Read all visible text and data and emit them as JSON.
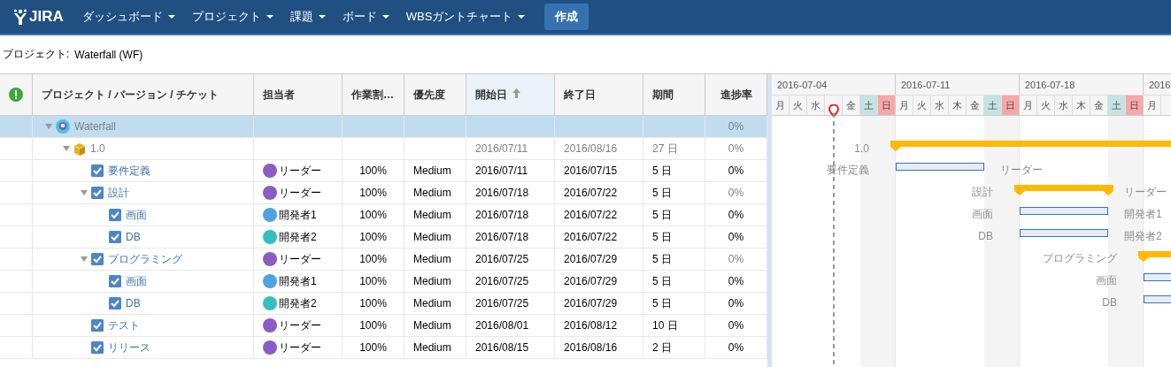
{
  "nav": {
    "logo": "JIRA",
    "menus": [
      {
        "label": "ダッシュボード"
      },
      {
        "label": "プロジェクト"
      },
      {
        "label": "課題"
      },
      {
        "label": "ボード"
      },
      {
        "label": "WBSガントチャート"
      }
    ],
    "create_button": "作成"
  },
  "project": {
    "label": "プロジェクト:",
    "value": "Waterfall (WF)"
  },
  "table": {
    "columns": [
      {
        "label": "プロジェクト / バージョン / チケット",
        "sorted": false
      },
      {
        "label": "担当者",
        "sorted": false
      },
      {
        "label": "作業割…",
        "sorted": false
      },
      {
        "label": "優先度",
        "sorted": false
      },
      {
        "label": "開始日",
        "sorted": true
      },
      {
        "label": "終了日",
        "sorted": false
      },
      {
        "label": "期間",
        "sorted": false
      },
      {
        "label": "進捗率",
        "sorted": false
      }
    ],
    "rows": [
      {
        "name": "Waterfall",
        "kind": "project",
        "selected": true,
        "expanded": true,
        "progress": "0%",
        "children": [
          {
            "name": "1.0",
            "kind": "version",
            "selected": false,
            "expanded": true,
            "start": "2016/07/11",
            "end": "2016/08/16",
            "duration": "27 日",
            "progress": "0%",
            "gantt_label": "1.0",
            "children": [
              {
                "name": "要件定義",
                "kind": "task",
                "selected": false,
                "assignee": "リーダー",
                "color": "#8a5cc4",
                "ratio": "100%",
                "priority": "Medium",
                "start": "2016/07/11",
                "end": "2016/07/15",
                "duration": "5 日",
                "progress": "0%",
                "gantt_label": "要件定義",
                "gantt_assignee": "リーダー"
              },
              {
                "name": "設計",
                "kind": "parent",
                "selected": false,
                "expanded": true,
                "assignee": "リーダー",
                "color": "#8a5cc4",
                "ratio": "100%",
                "priority": "Medium",
                "start": "2016/07/18",
                "end": "2016/07/22",
                "duration": "5 日",
                "progress": "0%",
                "gantt_label": "設計",
                "gantt_assignee": "リーダー",
                "children": [
                  {
                    "name": "画面",
                    "kind": "task",
                    "selected": false,
                    "assignee": "開発者1",
                    "color": "#4fa3e0",
                    "ratio": "100%",
                    "priority": "Medium",
                    "start": "2016/07/18",
                    "end": "2016/07/22",
                    "duration": "5 日",
                    "progress": "0%",
                    "gantt_label": "画面",
                    "gantt_assignee": "開発者1"
                  },
                  {
                    "name": "DB",
                    "kind": "task",
                    "selected": false,
                    "assignee": "開発者2",
                    "color": "#35bfbf",
                    "ratio": "100%",
                    "priority": "Medium",
                    "start": "2016/07/18",
                    "end": "2016/07/22",
                    "duration": "5 日",
                    "progress": "0%",
                    "gantt_label": "DB",
                    "gantt_assignee": "開発者2"
                  }
                ]
              },
              {
                "name": "プログラミング",
                "kind": "parent",
                "selected": false,
                "expanded": true,
                "assignee": "リーダー",
                "color": "#8a5cc4",
                "ratio": "100%",
                "priority": "Medium",
                "start": "2016/07/25",
                "end": "2016/07/29",
                "duration": "5 日",
                "progress": "0%",
                "gantt_label": "プログラミング",
                "children": [
                  {
                    "name": "画面",
                    "kind": "task",
                    "selected": false,
                    "assignee": "開発者1",
                    "color": "#4fa3e0",
                    "ratio": "100%",
                    "priority": "Medium",
                    "start": "2016/07/25",
                    "end": "2016/07/29",
                    "duration": "5 日",
                    "progress": "0%",
                    "gantt_label": "画面"
                  },
                  {
                    "name": "DB",
                    "kind": "task",
                    "selected": false,
                    "assignee": "開発者2",
                    "color": "#35bfbf",
                    "ratio": "100%",
                    "priority": "Medium",
                    "start": "2016/07/25",
                    "end": "2016/07/29",
                    "duration": "5 日",
                    "progress": "0%",
                    "gantt_label": "DB"
                  }
                ]
              },
              {
                "name": "テスト",
                "kind": "task",
                "selected": false,
                "assignee": "リーダー",
                "color": "#8a5cc4",
                "ratio": "100%",
                "priority": "Medium",
                "start": "2016/08/01",
                "end": "2016/08/12",
                "duration": "10 日",
                "progress": "0%"
              },
              {
                "name": "リリース",
                "kind": "task",
                "selected": false,
                "assignee": "リーダー",
                "color": "#8a5cc4",
                "ratio": "100%",
                "priority": "Medium",
                "start": "2016/08/15",
                "end": "2016/08/16",
                "duration": "2 日",
                "progress": "0%"
              }
            ]
          }
        ]
      }
    ]
  },
  "gantt": {
    "weeks": [
      {
        "label": "2016-07-04"
      },
      {
        "label": "2016-07-11"
      },
      {
        "label": "2016-07-18"
      },
      {
        "label": "2016"
      }
    ],
    "days": [
      {
        "label": "月",
        "kind": "weekday",
        "today": false
      },
      {
        "label": "火",
        "kind": "weekday",
        "today": false
      },
      {
        "label": "水",
        "kind": "weekday",
        "today": false
      },
      {
        "kind": "weekday",
        "today": true
      },
      {
        "label": "金",
        "kind": "weekday",
        "today": false
      },
      {
        "label": "土",
        "kind": "saturday",
        "today": false
      },
      {
        "label": "日",
        "kind": "sunday",
        "today": false
      },
      {
        "label": "月",
        "kind": "weekday",
        "today": false
      },
      {
        "label": "火",
        "kind": "weekday",
        "today": false
      },
      {
        "label": "水",
        "kind": "weekday",
        "today": false
      },
      {
        "label": "木",
        "kind": "weekday",
        "today": false
      },
      {
        "label": "金",
        "kind": "weekday",
        "today": false
      },
      {
        "label": "土",
        "kind": "saturday",
        "today": false
      },
      {
        "label": "日",
        "kind": "sunday",
        "today": false
      },
      {
        "label": "月",
        "kind": "weekday",
        "today": false
      },
      {
        "label": "火",
        "kind": "weekday",
        "today": false
      },
      {
        "label": "水",
        "kind": "weekday",
        "today": false
      },
      {
        "label": "木",
        "kind": "weekday",
        "today": false
      },
      {
        "label": "金",
        "kind": "weekday",
        "today": false
      },
      {
        "label": "土",
        "kind": "saturday",
        "today": false
      },
      {
        "label": "日",
        "kind": "sunday",
        "today": false
      },
      {
        "label": "月",
        "kind": "weekday",
        "today": false
      }
    ]
  }
}
